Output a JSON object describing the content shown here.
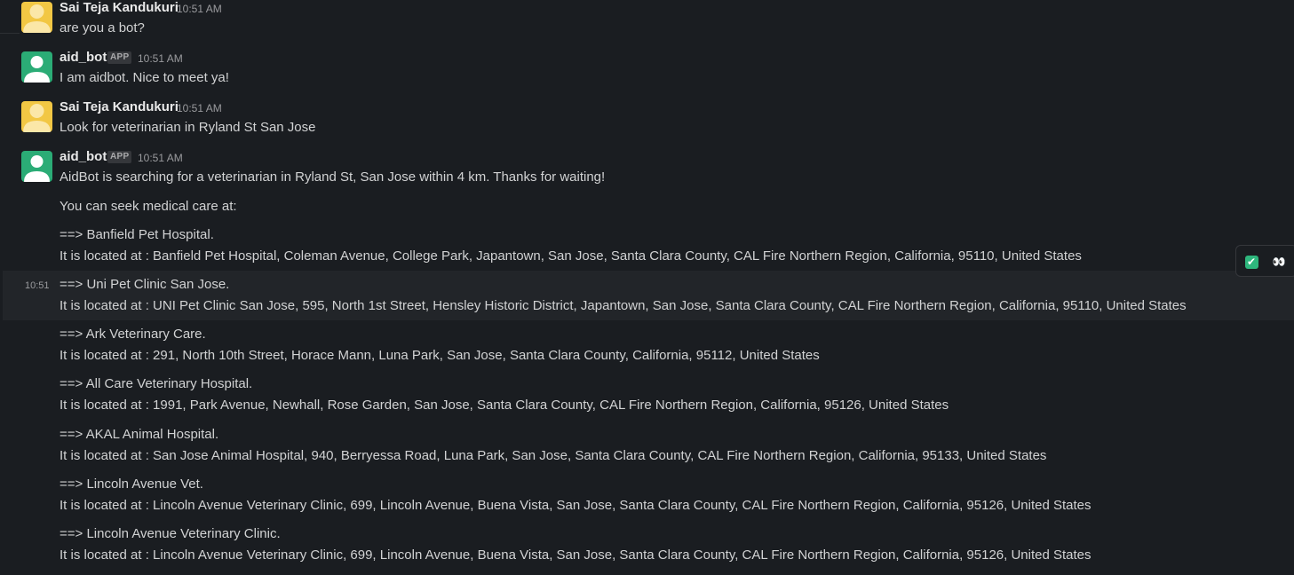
{
  "messages": [
    {
      "author": "Sai Teja Kandukuri",
      "time": "10:51 AM",
      "text": "are you a bot?"
    },
    {
      "author": "aid_bot",
      "badge": "APP",
      "time": "10:51 AM",
      "text": "I am aidbot. Nice to meet ya!"
    },
    {
      "author": "Sai Teja Kandukuri",
      "time": "10:51 AM",
      "text": "Look for veterinarian in Ryland St San Jose"
    },
    {
      "author": "aid_bot",
      "badge": "APP",
      "time": "10:51 AM",
      "text": "AidBot is searching for a veterinarian in Ryland St, San Jose within 4 km. Thanks for waiting!"
    }
  ],
  "followups": {
    "intro": "You can seek medical care at:",
    "hover_time": "10:51",
    "results": [
      {
        "name": "==> Banfield Pet Hospital.",
        "location": "It is located at : Banfield Pet Hospital, Coleman Avenue, College Park, Japantown, San Jose, Santa Clara County, CAL Fire Northern Region, California, 95110, United States"
      },
      {
        "name": "==> Uni Pet Clinic San Jose.",
        "location": "It is located at : UNI Pet Clinic San Jose, 595, North 1st Street, Hensley Historic District, Japantown, San Jose, Santa Clara County, CAL Fire Northern Region, California, 95110, United States"
      },
      {
        "name": "==> Ark Veterinary Care.",
        "location": "It is located at : 291, North 10th Street, Horace Mann, Luna Park, San Jose, Santa Clara County, California, 95112, United States"
      },
      {
        "name": "==> All Care Veterinary Hospital.",
        "location": "It is located at : 1991, Park Avenue, Newhall, Rose Garden, San Jose, Santa Clara County, CAL Fire Northern Region, California, 95126, United States"
      },
      {
        "name": "==> AKAL Animal Hospital.",
        "location": "It is located at : San Jose Animal Hospital, 940, Berryessa Road, Luna Park, San Jose, Santa Clara County, CAL Fire Northern Region, California, 95133, United States"
      },
      {
        "name": "==> Lincoln Avenue Vet.",
        "location": "It is located at : Lincoln Avenue Veterinary Clinic, 699, Lincoln Avenue, Buena Vista, San Jose, Santa Clara County, CAL Fire Northern Region, California, 95126, United States"
      },
      {
        "name": "==> Lincoln Avenue Veterinary Clinic.",
        "location": "It is located at : Lincoln Avenue Veterinary Clinic, 699, Lincoln Avenue, Buena Vista, San Jose, Santa Clara County, CAL Fire Northern Region, California, 95126, United States"
      }
    ]
  },
  "reactions": [
    {
      "icon": "white-check-mark-icon",
      "glyph": "✔"
    },
    {
      "icon": "eyes-icon",
      "glyph": "👀"
    }
  ],
  "colors": {
    "background": "#1a1d21",
    "hover_row": "#222529",
    "user_avatar": "#f2c744",
    "bot_avatar": "#2bac76"
  }
}
